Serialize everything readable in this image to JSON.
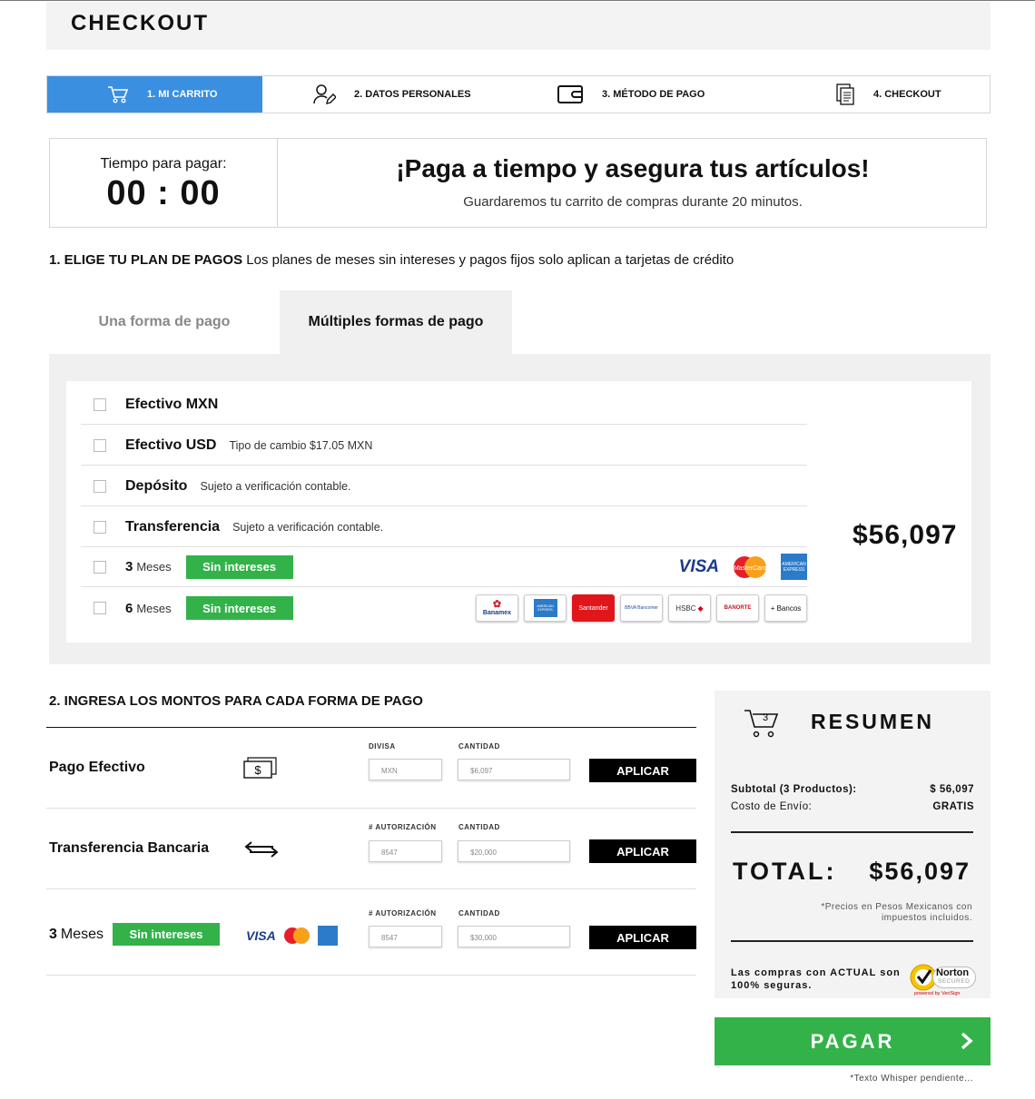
{
  "header": {
    "title": "CHECKOUT"
  },
  "steps": [
    {
      "label": "1. MI CARRITO",
      "icon": "cart-icon",
      "active": true
    },
    {
      "label": "2. DATOS PERSONALES",
      "icon": "user-edit-icon",
      "active": false
    },
    {
      "label": "3. MÉTODO DE PAGO",
      "icon": "wallet-icon",
      "active": false
    },
    {
      "label": "4. CHECKOUT",
      "icon": "receipt-icon",
      "active": false
    }
  ],
  "timer": {
    "label": "Tiempo para pagar:",
    "value": "00 : 00",
    "headline": "¡Paga a tiempo y asegura tus artículos!",
    "subtitle": "Guardaremos tu carrito de compras durante 20 minutos."
  },
  "plan": {
    "title_bold": "1. ELIGE TU PLAN DE PAGOS",
    "title_rest": " Los planes de meses sin intereses y pagos fijos solo aplican a tarjetas de crédito",
    "tabs": [
      "Una forma de pago",
      "Múltiples formas de pago"
    ],
    "rows": [
      {
        "name": "Efectivo MXN",
        "note": ""
      },
      {
        "name": "Efectivo USD",
        "note": "Tipo de cambio $17.05 MXN"
      },
      {
        "name": "Depósito",
        "note": "Sujeto a verificación contable."
      },
      {
        "name": "Transferencia",
        "note": "Sujeto a verificación contable."
      }
    ],
    "meses_rows": [
      {
        "num": "3",
        "label": "Meses",
        "badge": "Sin intereses"
      },
      {
        "num": "6",
        "label": "Meses",
        "badge": "Sin intereses"
      }
    ],
    "cards": [
      "VISA",
      "MasterCard",
      "AMERICAN EXPRESS"
    ],
    "banks": [
      "Banamex",
      "AMERICAN EXPRESS",
      "Santander",
      "BBVA Bancomer",
      "HSBC",
      "BANORTE",
      "+ Bancos"
    ],
    "total": "$56,097"
  },
  "amounts": {
    "title": "2. INGRESA LOS MONTOS PARA CADA FORMA DE PAGO",
    "rows": [
      {
        "label": "Pago Efectivo",
        "col1_header": "DIVISA",
        "col1_value": "MXN",
        "col2_header": "CANTIDAD",
        "col2_value": "$6,097",
        "button": "APLICAR"
      },
      {
        "label": "Transferencia Bancaria",
        "col1_header": "# AUTORIZACIÓN",
        "col1_value": "8547",
        "col2_header": "CANTIDAD",
        "col2_value": "$20,000",
        "button": "APLICAR"
      },
      {
        "label_num": "3",
        "label": "Meses",
        "badge": "Sin intereses",
        "col1_header": "# AUTORIZACIÓN",
        "col1_value": "8547",
        "col2_header": "CANTIDAD",
        "col2_value": "$30,000",
        "button": "APLICAR"
      }
    ]
  },
  "summary": {
    "cart_count": "3",
    "title": "RESUMEN",
    "subtotal_label": "Subtotal (3 Productos):",
    "subtotal_value": "$ 56,097",
    "shipping_label": "Costo de Envío:",
    "shipping_value": "GRATIS",
    "total_label": "TOTAL:",
    "total_value": "$56,097",
    "note": "*Precios en Pesos Mexicanos con impuestos incluidos.",
    "secure_text": "Las compras con ACTUAL son 100% seguras.",
    "norton_title": "Norton",
    "norton_sub": "SECURED",
    "norton_powered": "powered by VeriSign"
  },
  "pay_button": "PAGAR",
  "footnote": "*Texto Whisper pendiente...",
  "colors": {
    "accent_blue": "#3a8fe0",
    "green": "#33b24a"
  }
}
